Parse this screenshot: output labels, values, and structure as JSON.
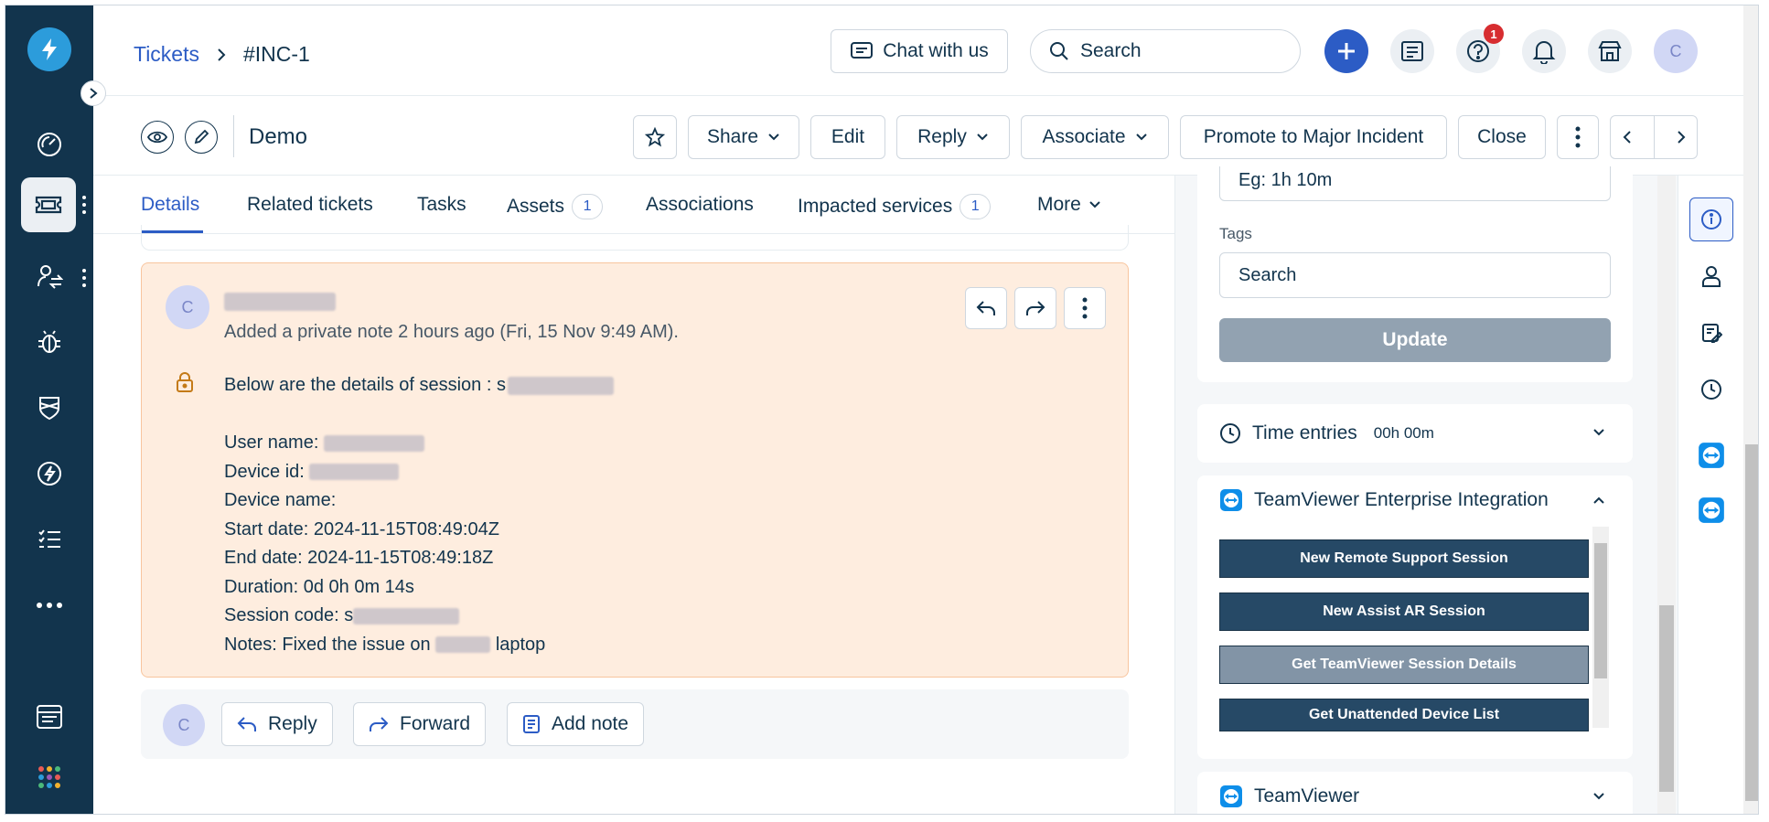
{
  "header": {
    "breadcrumb_tickets": "Tickets",
    "breadcrumb_current": "#INC-1",
    "chat_label": "Chat with us",
    "search_placeholder": "Search",
    "help_badge": "1",
    "avatar_initial": "C"
  },
  "subheader": {
    "title": "Demo",
    "share_label": "Share",
    "edit_label": "Edit",
    "reply_label": "Reply",
    "associate_label": "Associate",
    "promote_label": "Promote to Major Incident",
    "close_label": "Close"
  },
  "tabs": [
    {
      "label": "Details"
    },
    {
      "label": "Related tickets"
    },
    {
      "label": "Tasks"
    },
    {
      "label": "Assets",
      "count": "1"
    },
    {
      "label": "Associations"
    },
    {
      "label": "Impacted services",
      "count": "1"
    },
    {
      "label": "More"
    }
  ],
  "note": {
    "avatar_initial": "C",
    "meta": "Added a private note 2 hours ago (Fri, 15 Nov 9:49 AM).",
    "line_session": "Below are the details of session : s",
    "line_user": "User name:",
    "line_device_id": "Device id:",
    "line_device_name": "Device name:",
    "line_start": "Start date: 2024-11-15T08:49:04Z",
    "line_end": "End date: 2024-11-15T08:49:18Z",
    "line_duration": "Duration: 0d 0h 0m 14s",
    "line_code": "Session code: s",
    "line_notes_pre": "Notes: Fixed the issue on",
    "line_notes_post": "laptop"
  },
  "replybar": {
    "avatar_initial": "C",
    "reply_label": "Reply",
    "forward_label": "Forward",
    "add_note_label": "Add note"
  },
  "rightpanel": {
    "time_placeholder": "Eg: 1h 10m",
    "tags_label": "Tags",
    "tags_placeholder": "Search",
    "update_label": "Update",
    "time_entries_label": "Time entries",
    "time_entries_value": "00h 00m",
    "tv_integration_title": "TeamViewer Enterprise Integration",
    "tv_buttons": [
      "New Remote Support Session",
      "New Assist AR Session",
      "Get TeamViewer Session Details",
      "Get Unattended Device List"
    ],
    "tv_title": "TeamViewer"
  },
  "colors": {
    "nav_bg": "#12344d",
    "accent": "#2c5cc5",
    "note_bg": "#feeddf",
    "tv_button": "#264966"
  }
}
